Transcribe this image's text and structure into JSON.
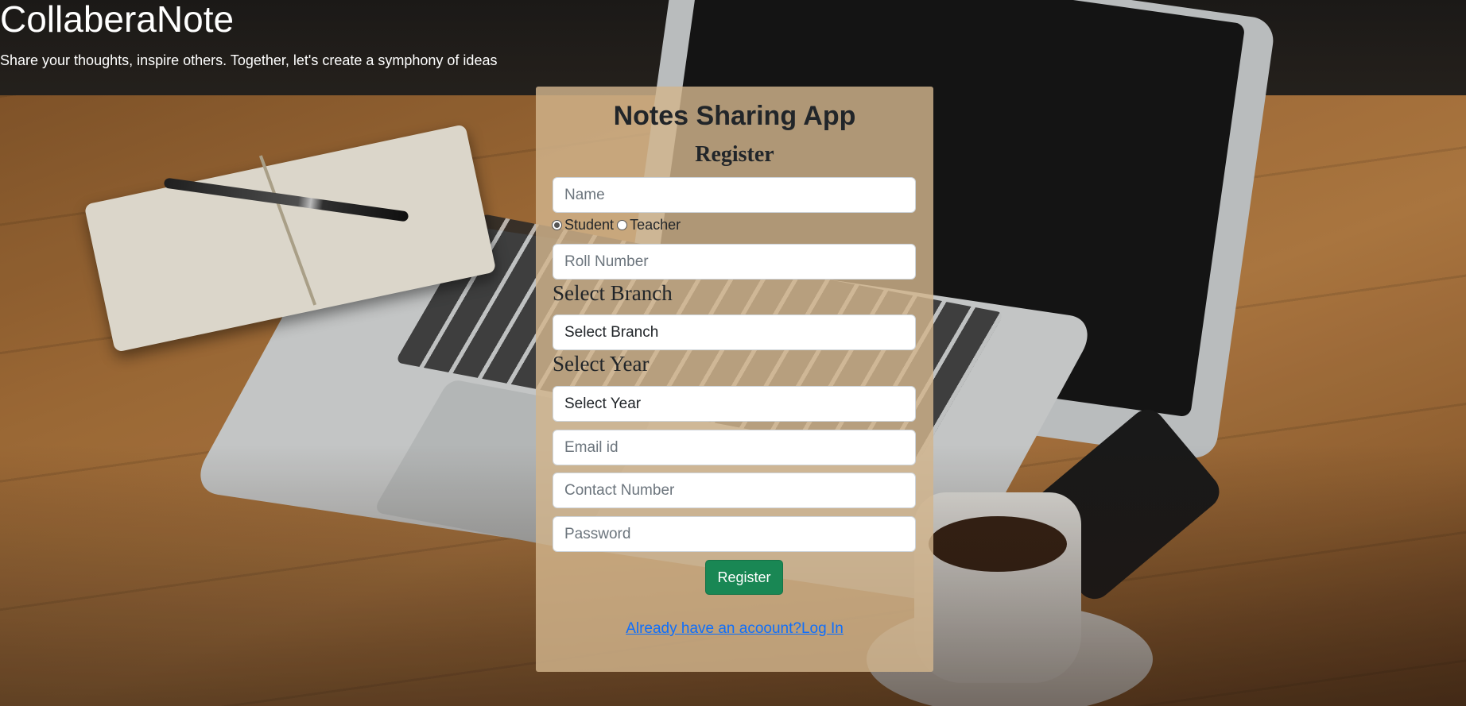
{
  "header": {
    "brand": "CollaberaNote",
    "tagline": "Share your thoughts, inspire others. Together, let's create a symphony of ideas"
  },
  "form": {
    "title": "Notes Sharing App",
    "subtitle": "Register",
    "name_placeholder": "Name",
    "role_options": [
      {
        "label": "Student",
        "selected": true
      },
      {
        "label": "Teacher",
        "selected": false
      }
    ],
    "roll_placeholder": "Roll Number",
    "branch_label": "Select Branch",
    "branch_value": "Select Branch",
    "year_label": "Select Year",
    "year_value": "Select Year",
    "email_placeholder": "Email id",
    "contact_placeholder": "Contact Number",
    "password_placeholder": "Password",
    "submit_label": "Register",
    "login_link": "Already have an acoount?Log In"
  },
  "colors": {
    "button": "#198754",
    "link": "#0d6efd",
    "card": "#d2b48c"
  }
}
